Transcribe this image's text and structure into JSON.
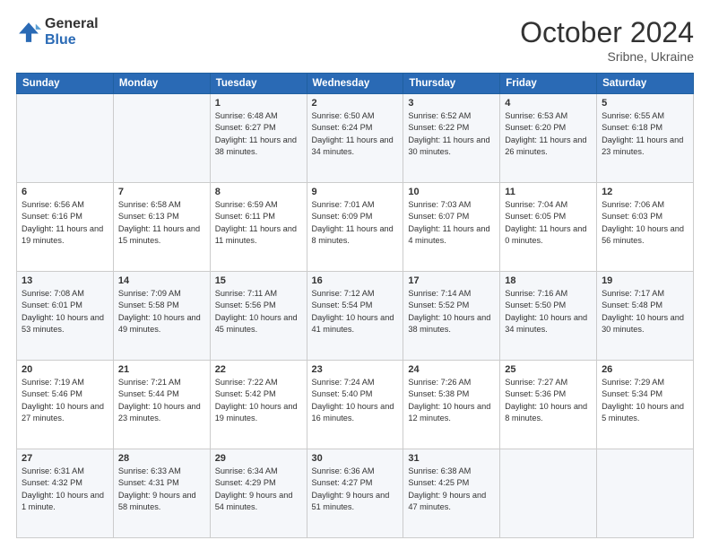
{
  "header": {
    "logo_general": "General",
    "logo_blue": "Blue",
    "month_title": "October 2024",
    "location": "Sribne, Ukraine"
  },
  "weekdays": [
    "Sunday",
    "Monday",
    "Tuesday",
    "Wednesday",
    "Thursday",
    "Friday",
    "Saturday"
  ],
  "weeks": [
    [
      {
        "day": "",
        "sunrise": "",
        "sunset": "",
        "daylight": ""
      },
      {
        "day": "",
        "sunrise": "",
        "sunset": "",
        "daylight": ""
      },
      {
        "day": "1",
        "sunrise": "Sunrise: 6:48 AM",
        "sunset": "Sunset: 6:27 PM",
        "daylight": "Daylight: 11 hours and 38 minutes."
      },
      {
        "day": "2",
        "sunrise": "Sunrise: 6:50 AM",
        "sunset": "Sunset: 6:24 PM",
        "daylight": "Daylight: 11 hours and 34 minutes."
      },
      {
        "day": "3",
        "sunrise": "Sunrise: 6:52 AM",
        "sunset": "Sunset: 6:22 PM",
        "daylight": "Daylight: 11 hours and 30 minutes."
      },
      {
        "day": "4",
        "sunrise": "Sunrise: 6:53 AM",
        "sunset": "Sunset: 6:20 PM",
        "daylight": "Daylight: 11 hours and 26 minutes."
      },
      {
        "day": "5",
        "sunrise": "Sunrise: 6:55 AM",
        "sunset": "Sunset: 6:18 PM",
        "daylight": "Daylight: 11 hours and 23 minutes."
      }
    ],
    [
      {
        "day": "6",
        "sunrise": "Sunrise: 6:56 AM",
        "sunset": "Sunset: 6:16 PM",
        "daylight": "Daylight: 11 hours and 19 minutes."
      },
      {
        "day": "7",
        "sunrise": "Sunrise: 6:58 AM",
        "sunset": "Sunset: 6:13 PM",
        "daylight": "Daylight: 11 hours and 15 minutes."
      },
      {
        "day": "8",
        "sunrise": "Sunrise: 6:59 AM",
        "sunset": "Sunset: 6:11 PM",
        "daylight": "Daylight: 11 hours and 11 minutes."
      },
      {
        "day": "9",
        "sunrise": "Sunrise: 7:01 AM",
        "sunset": "Sunset: 6:09 PM",
        "daylight": "Daylight: 11 hours and 8 minutes."
      },
      {
        "day": "10",
        "sunrise": "Sunrise: 7:03 AM",
        "sunset": "Sunset: 6:07 PM",
        "daylight": "Daylight: 11 hours and 4 minutes."
      },
      {
        "day": "11",
        "sunrise": "Sunrise: 7:04 AM",
        "sunset": "Sunset: 6:05 PM",
        "daylight": "Daylight: 11 hours and 0 minutes."
      },
      {
        "day": "12",
        "sunrise": "Sunrise: 7:06 AM",
        "sunset": "Sunset: 6:03 PM",
        "daylight": "Daylight: 10 hours and 56 minutes."
      }
    ],
    [
      {
        "day": "13",
        "sunrise": "Sunrise: 7:08 AM",
        "sunset": "Sunset: 6:01 PM",
        "daylight": "Daylight: 10 hours and 53 minutes."
      },
      {
        "day": "14",
        "sunrise": "Sunrise: 7:09 AM",
        "sunset": "Sunset: 5:58 PM",
        "daylight": "Daylight: 10 hours and 49 minutes."
      },
      {
        "day": "15",
        "sunrise": "Sunrise: 7:11 AM",
        "sunset": "Sunset: 5:56 PM",
        "daylight": "Daylight: 10 hours and 45 minutes."
      },
      {
        "day": "16",
        "sunrise": "Sunrise: 7:12 AM",
        "sunset": "Sunset: 5:54 PM",
        "daylight": "Daylight: 10 hours and 41 minutes."
      },
      {
        "day": "17",
        "sunrise": "Sunrise: 7:14 AM",
        "sunset": "Sunset: 5:52 PM",
        "daylight": "Daylight: 10 hours and 38 minutes."
      },
      {
        "day": "18",
        "sunrise": "Sunrise: 7:16 AM",
        "sunset": "Sunset: 5:50 PM",
        "daylight": "Daylight: 10 hours and 34 minutes."
      },
      {
        "day": "19",
        "sunrise": "Sunrise: 7:17 AM",
        "sunset": "Sunset: 5:48 PM",
        "daylight": "Daylight: 10 hours and 30 minutes."
      }
    ],
    [
      {
        "day": "20",
        "sunrise": "Sunrise: 7:19 AM",
        "sunset": "Sunset: 5:46 PM",
        "daylight": "Daylight: 10 hours and 27 minutes."
      },
      {
        "day": "21",
        "sunrise": "Sunrise: 7:21 AM",
        "sunset": "Sunset: 5:44 PM",
        "daylight": "Daylight: 10 hours and 23 minutes."
      },
      {
        "day": "22",
        "sunrise": "Sunrise: 7:22 AM",
        "sunset": "Sunset: 5:42 PM",
        "daylight": "Daylight: 10 hours and 19 minutes."
      },
      {
        "day": "23",
        "sunrise": "Sunrise: 7:24 AM",
        "sunset": "Sunset: 5:40 PM",
        "daylight": "Daylight: 10 hours and 16 minutes."
      },
      {
        "day": "24",
        "sunrise": "Sunrise: 7:26 AM",
        "sunset": "Sunset: 5:38 PM",
        "daylight": "Daylight: 10 hours and 12 minutes."
      },
      {
        "day": "25",
        "sunrise": "Sunrise: 7:27 AM",
        "sunset": "Sunset: 5:36 PM",
        "daylight": "Daylight: 10 hours and 8 minutes."
      },
      {
        "day": "26",
        "sunrise": "Sunrise: 7:29 AM",
        "sunset": "Sunset: 5:34 PM",
        "daylight": "Daylight: 10 hours and 5 minutes."
      }
    ],
    [
      {
        "day": "27",
        "sunrise": "Sunrise: 6:31 AM",
        "sunset": "Sunset: 4:32 PM",
        "daylight": "Daylight: 10 hours and 1 minute."
      },
      {
        "day": "28",
        "sunrise": "Sunrise: 6:33 AM",
        "sunset": "Sunset: 4:31 PM",
        "daylight": "Daylight: 9 hours and 58 minutes."
      },
      {
        "day": "29",
        "sunrise": "Sunrise: 6:34 AM",
        "sunset": "Sunset: 4:29 PM",
        "daylight": "Daylight: 9 hours and 54 minutes."
      },
      {
        "day": "30",
        "sunrise": "Sunrise: 6:36 AM",
        "sunset": "Sunset: 4:27 PM",
        "daylight": "Daylight: 9 hours and 51 minutes."
      },
      {
        "day": "31",
        "sunrise": "Sunrise: 6:38 AM",
        "sunset": "Sunset: 4:25 PM",
        "daylight": "Daylight: 9 hours and 47 minutes."
      },
      {
        "day": "",
        "sunrise": "",
        "sunset": "",
        "daylight": ""
      },
      {
        "day": "",
        "sunrise": "",
        "sunset": "",
        "daylight": ""
      }
    ]
  ]
}
